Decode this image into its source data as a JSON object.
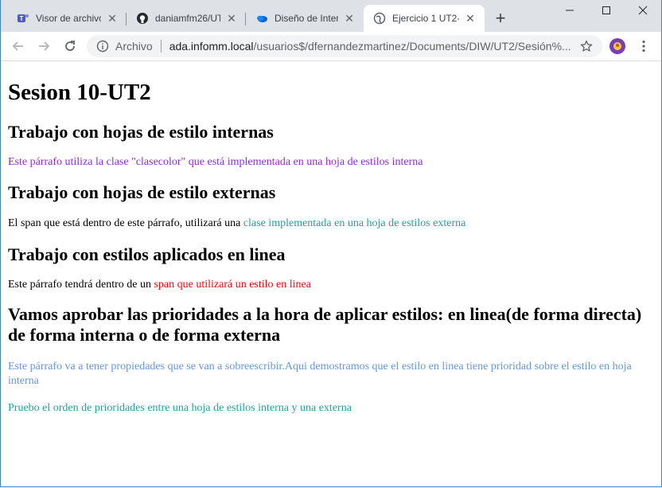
{
  "browser": {
    "tabs": [
      {
        "title": "Visor de archivos",
        "icon": "teams-icon"
      },
      {
        "title": "daniamfm26/UT",
        "icon": "github-icon"
      },
      {
        "title": "Diseño de Interf",
        "icon": "onedrive-icon"
      },
      {
        "title": "Ejercicio 1 UT2-",
        "icon": "globe-icon",
        "active": true
      }
    ],
    "address": {
      "scheme_label": "Archivo",
      "host": "ada.infomm.local",
      "path": "/usuarios$/dfernandezmartinez/Documents/DIW/UT2/Sesión%..."
    }
  },
  "page": {
    "title": "Sesion 10-UT2",
    "sections": [
      {
        "heading": "Trabajo con hojas de estilo internas"
      },
      {
        "heading": "Trabajo con hojas de estilo externas"
      },
      {
        "heading": "Trabajo con estilos aplicados en linea"
      },
      {
        "heading": "Vamos aprobar las prioridades a la hora de aplicar estilos: en linea(de forma directa) de forma interna o de forma externa"
      }
    ],
    "p_internal": "Este párrafo utiliza la clase \"clasecolor\" que está implementada en una hoja de estilos interna",
    "p_external_prefix": "El span que está dentro de este párrafo, utilizará una ",
    "p_external_span": "clase implementada en una hoja de estilos externa",
    "p_inline_prefix": "Este párrafo tendrá dentro de un ",
    "p_inline_span": "span que utilizará un estilo en linea",
    "p_priority_1": "Este párrafo va a tener propiedades que se van a sobreescribir.Aqui demostramos que el estilo en linea tiene prioridad sobre el estilo en hoja interna",
    "p_priority_2": "Pruebo el orden de prioridades entre una hoja de estilos interna y una externa"
  },
  "colors": {
    "purple": "#8a2be2",
    "teal": "#20a39e",
    "red": "#ff0000",
    "cornflower": "#6495ed",
    "tabstrip": "#dee1e6"
  }
}
